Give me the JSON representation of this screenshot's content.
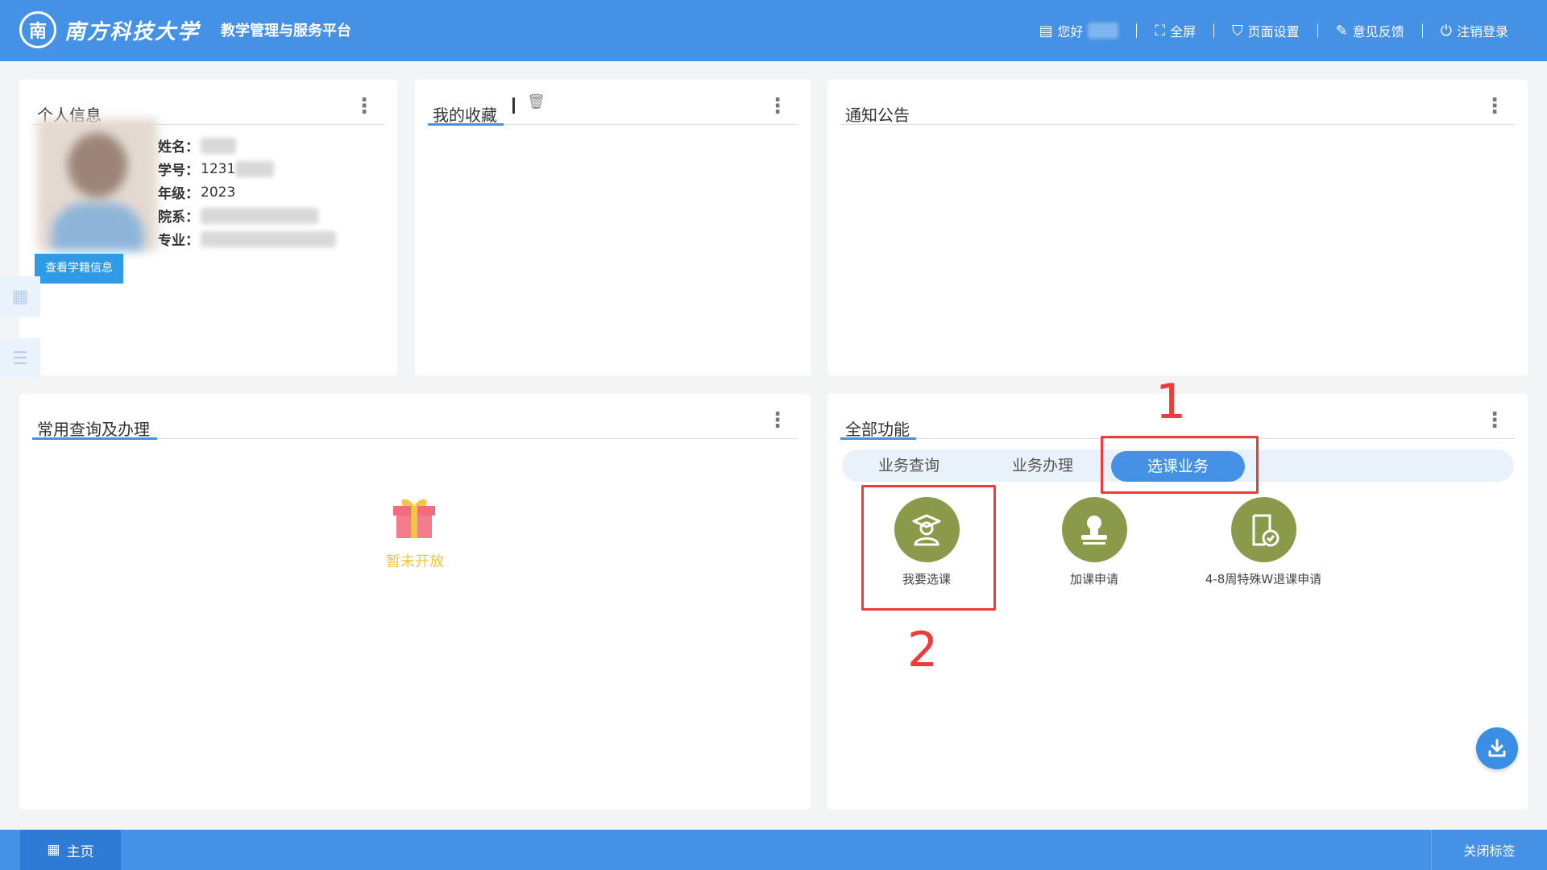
{
  "header": {
    "university": "南方科技大学",
    "logo_mark": "南",
    "platform": "教学管理与服务平台",
    "greeting": "您好",
    "fullscreen": "全屏",
    "page_settings": "页面设置",
    "feedback": "意见反馈",
    "logout": "注销登录"
  },
  "personal": {
    "title": "个人信息",
    "name_label": "姓名：",
    "id_label": "学号：",
    "id_value": "1231",
    "grade_label": "年级：",
    "grade_value": "2023",
    "dept_label": "院系：",
    "major_label": "专业：",
    "view_button": "查看学籍信息"
  },
  "favorites": {
    "title": "我的收藏"
  },
  "notices": {
    "title": "通知公告"
  },
  "common": {
    "title": "常用查询及办理",
    "empty_text": "暂未开放"
  },
  "functions": {
    "title": "全部功能",
    "tabs": [
      {
        "label": "业务查询"
      },
      {
        "label": "业务办理"
      },
      {
        "label": "选课业务"
      }
    ],
    "items": [
      {
        "label": "我要选课",
        "icon": "student-icon"
      },
      {
        "label": "加课申请",
        "icon": "stamp-icon"
      },
      {
        "label": "4-8周特殊W退课申请",
        "icon": "document-check-icon"
      }
    ],
    "annotation_1": "1",
    "annotation_2": "2"
  },
  "footer": {
    "home": "主页",
    "close_tabs": "关闭标签"
  },
  "colors": {
    "primary": "#4591e6",
    "function_icon": "#8a9a4a",
    "annotation": "#ee3b3b",
    "empty_text": "#f3c546"
  }
}
